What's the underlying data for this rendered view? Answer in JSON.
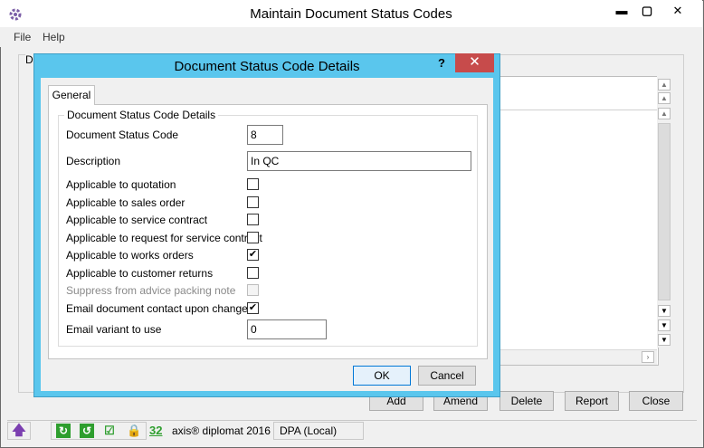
{
  "main_window": {
    "title": "Maintain Document Status Codes",
    "minimize_glyph": "▬",
    "maximize_glyph": "▢",
    "close_glyph": "✕"
  },
  "menu": [
    "File",
    "Help"
  ],
  "background": {
    "group_label": "D",
    "buttons": [
      "Add",
      "Amend",
      "Delete",
      "Report",
      "Close"
    ]
  },
  "status_bar": {
    "count": "32",
    "product": "axis® diplomat 2016",
    "database": "DPA (Local)"
  },
  "dialog": {
    "title": "Document Status Code Details",
    "help_glyph": "?",
    "close_glyph": "✕",
    "tab": "General",
    "group_title": "Document Status Code Details",
    "fields": {
      "status_code_label": "Document Status Code",
      "status_code_value": "8",
      "description_label": "Description",
      "description_value": "In QC",
      "email_variant_label": "Email variant to use",
      "email_variant_value": "0"
    },
    "checkboxes": [
      {
        "label": "Applicable to quotation",
        "checked": false,
        "enabled": true
      },
      {
        "label": "Applicable to sales order",
        "checked": false,
        "enabled": true
      },
      {
        "label": "Applicable to service contract",
        "checked": false,
        "enabled": true
      },
      {
        "label": "Applicable to request for service contract",
        "checked": false,
        "enabled": true
      },
      {
        "label": "Applicable to works orders",
        "checked": true,
        "enabled": true
      },
      {
        "label": "Applicable to customer returns",
        "checked": false,
        "enabled": true
      },
      {
        "label": "Suppress from advice packing note",
        "checked": false,
        "enabled": false
      },
      {
        "label": "Email document contact upon change",
        "checked": true,
        "enabled": true
      }
    ],
    "ok_label": "OK",
    "cancel_label": "Cancel"
  },
  "colors": {
    "dialog_border": "#5ac6ed",
    "close_button": "#c74b4b",
    "status_green": "#2e9e2e"
  }
}
